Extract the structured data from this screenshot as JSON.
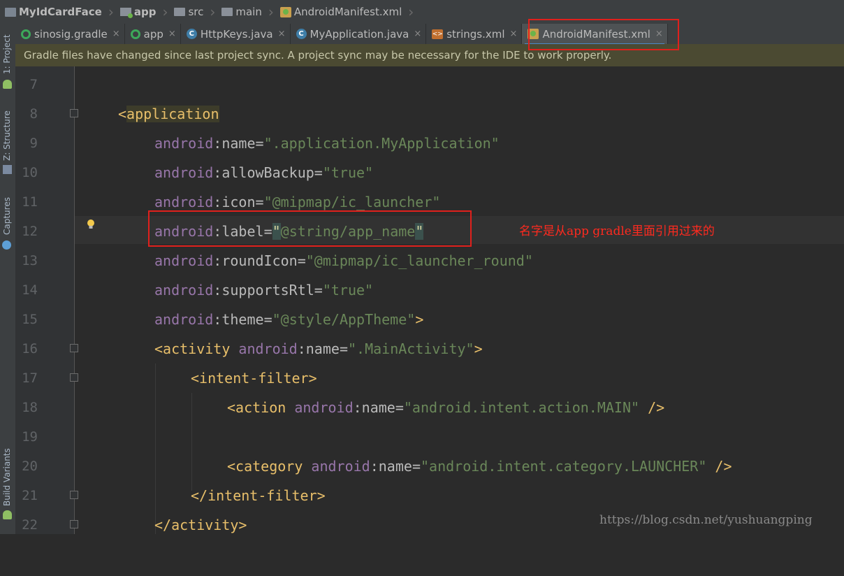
{
  "breadcrumb": [
    {
      "label": "MyIdCardFace",
      "icon": "project-icon",
      "bold": true
    },
    {
      "label": "app",
      "icon": "module-folder-icon",
      "bold": true
    },
    {
      "label": "src",
      "icon": "folder-icon",
      "bold": false
    },
    {
      "label": "main",
      "icon": "folder-icon",
      "bold": false
    },
    {
      "label": "AndroidManifest.xml",
      "icon": "manifest-icon",
      "bold": false
    }
  ],
  "tabs": [
    {
      "label": "sinosig.gradle",
      "icon": "gradle-icon"
    },
    {
      "label": "app",
      "icon": "gradle-icon"
    },
    {
      "label": "HttpKeys.java",
      "icon": "java-class-icon"
    },
    {
      "label": "MyApplication.java",
      "icon": "java-class-icon"
    },
    {
      "label": "strings.xml",
      "icon": "xml-icon"
    },
    {
      "label": "AndroidManifest.xml",
      "icon": "manifest-icon",
      "active": true
    }
  ],
  "close_glyph": "×",
  "banner": "Gradle files have changed since last project sync. A project sync may be necessary for the IDE to work properly.",
  "side_tabs": [
    "1: Project",
    "Z: Structure",
    "Captures",
    "Build Variants"
  ],
  "line_numbers": [
    "7",
    "8",
    "9",
    "10",
    "11",
    "12",
    "13",
    "14",
    "15",
    "16",
    "17",
    "18",
    "19",
    "20",
    "21",
    "22"
  ],
  "code": {
    "l8_open": "<",
    "l8_tag": "application",
    "ns": "android",
    "colon": ":",
    "l9_attr": "name",
    "l9_val": "\".application.MyApplication\"",
    "l10_attr": "allowBackup",
    "l10_val": "\"true\"",
    "l11_attr": "icon",
    "l11_val": "\"@mipmap/ic_launcher\"",
    "l12_attr": "label",
    "l12_q1": "\"",
    "l12_val": "@string/app_name",
    "l12_q2": "\"",
    "l13_attr": "roundIcon",
    "l13_val": "\"@mipmap/ic_launcher_round\"",
    "l14_attr": "supportsRtl",
    "l14_val": "\"true\"",
    "l15_attr": "theme",
    "l15_val": "\"@style/AppTheme\"",
    "l15_end": ">",
    "l16_tag": "<activity ",
    "l16_attr": "name",
    "l16_val": "\".MainActivity\"",
    "l16_end": ">",
    "l17": "<intent-filter>",
    "l18_tag": "<action ",
    "l18_attr": "name",
    "l18_val": "\"android.intent.action.MAIN\"",
    "l18_end": " />",
    "l20_tag": "<category ",
    "l20_attr": "name",
    "l20_val": "\"android.intent.category.LAUNCHER\"",
    "l20_end": " />",
    "l21": "</intent-filter>",
    "l22": "</activity>",
    "eq": "="
  },
  "annotation": "名字是从app gradle里面引用过来的",
  "watermark": "https://blog.csdn.net/yushuangping",
  "colors": {
    "annotation_red": "#e0201c",
    "tab_underline": "#4a88c7"
  }
}
